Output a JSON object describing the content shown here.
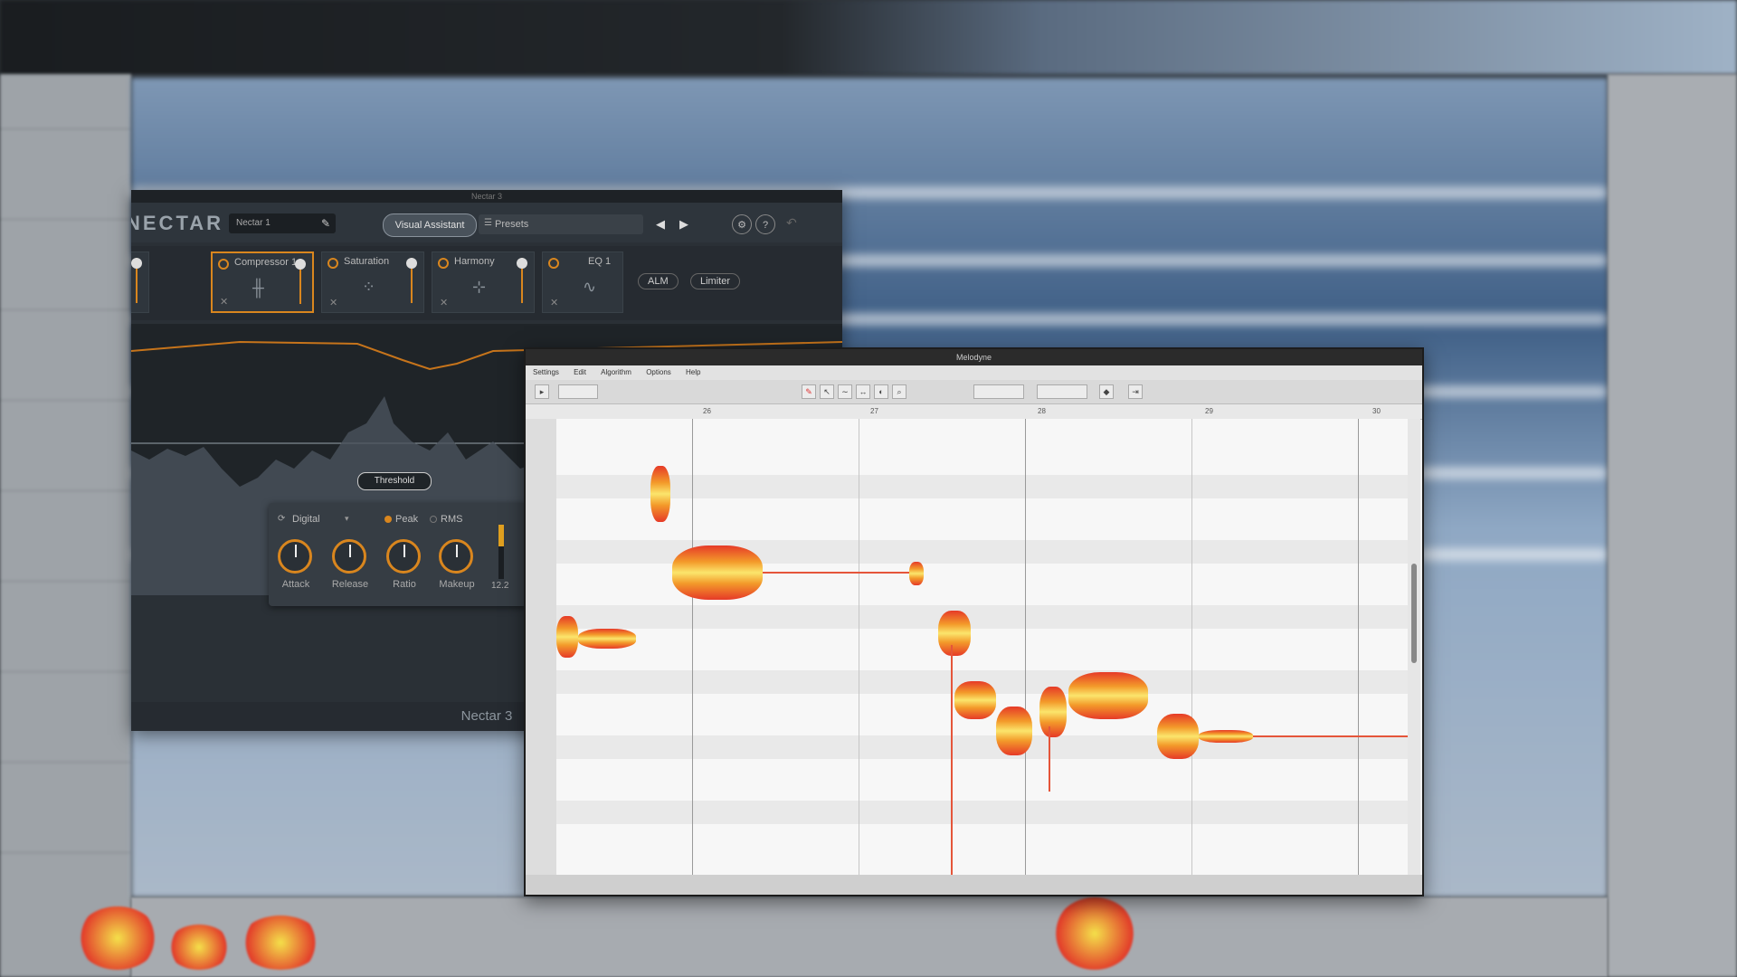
{
  "nectar": {
    "titlebar": "Nectar 3",
    "logo": "NECTAR",
    "preset_name": "Nectar 1",
    "visual_assistant": "Visual Assistant",
    "presets": "Presets",
    "modules": [
      {
        "label": "Compressor 1",
        "active": true
      },
      {
        "label": "Saturation",
        "active": false
      },
      {
        "label": "Harmony",
        "active": false
      },
      {
        "label": "EQ 1",
        "active": false
      }
    ],
    "alm": "ALM",
    "limiter": "Limiter",
    "threshold": "Threshold",
    "comp": {
      "mode": "Digital",
      "detect_peak": "Peak",
      "detect_rms": "RMS",
      "knobs": [
        "Attack",
        "Release",
        "Ratio",
        "Makeup"
      ],
      "meter_value": "12.2"
    },
    "footer": "Nectar 3"
  },
  "melodyne": {
    "title": "Melodyne",
    "menu": [
      "Settings",
      "Edit",
      "Algorithm",
      "Options",
      "Help"
    ],
    "ruler": [
      "26",
      "27",
      "28",
      "29",
      "30"
    ]
  },
  "colors": {
    "accent_orange": "#d9861e",
    "blob_red": "#e63a28",
    "blob_yellow": "#fbe56c"
  }
}
